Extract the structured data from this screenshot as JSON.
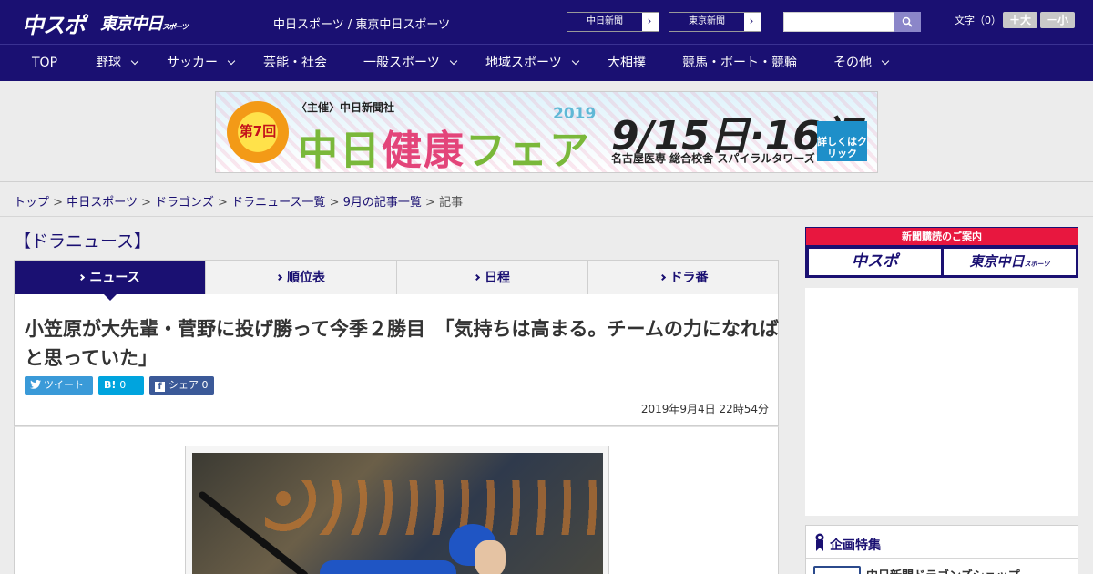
{
  "header": {
    "logo_main": "中スポ",
    "logo_sub": "東京中日",
    "logo_sub_small": "スポーツ",
    "site_title": "中日スポーツ / 東京中日スポーツ",
    "ext_links": [
      {
        "label": "中日新聞",
        "arrow": "›"
      },
      {
        "label": "東京新聞",
        "arrow": "›"
      }
    ],
    "search_placeholder": "",
    "font_size_label": "文字（0）",
    "font_larger": "＋大",
    "font_smaller": "－小"
  },
  "nav": {
    "items": [
      {
        "label": "TOP",
        "dropdown": false
      },
      {
        "label": "野球",
        "dropdown": true
      },
      {
        "label": "サッカー",
        "dropdown": true
      },
      {
        "label": "芸能・社会",
        "dropdown": false
      },
      {
        "label": "一般スポーツ",
        "dropdown": true
      },
      {
        "label": "地域スポーツ",
        "dropdown": true
      },
      {
        "label": "大相撲",
        "dropdown": false
      },
      {
        "label": "競馬・ボート・競輪",
        "dropdown": false
      },
      {
        "label": "その他",
        "dropdown": true
      }
    ]
  },
  "banner": {
    "flower_text": "第7回",
    "sponsor": "〈主催〉中日新聞社",
    "year": "2019",
    "title_a": "中日",
    "title_b": "健康",
    "title_c": "フェア",
    "dates": "9/15日·16祝",
    "venue": "名古屋医専 総合校舎 スパイラルタワーズ",
    "detail_label": "詳しくはクリック"
  },
  "breadcrumb": {
    "links": [
      "トップ",
      "中日スポーツ",
      "ドラゴンズ",
      "ドラニュース一覧",
      "9月の記事一覧"
    ],
    "current": "記事",
    "separator": ">"
  },
  "section_heading": "【ドラニュース】",
  "tabs": [
    {
      "label": "ニュース",
      "active": true
    },
    {
      "label": "順位表",
      "active": false
    },
    {
      "label": "日程",
      "active": false
    },
    {
      "label": "ドラ番",
      "active": false
    }
  ],
  "article": {
    "headline": "小笠原が大先輩・菅野に投げ勝って今季２勝目　「気持ちは高まる。チームの力になればと思っていた」",
    "share": {
      "tweet_label": "ツイート",
      "hatena_label": "B!",
      "hatena_count": "0",
      "facebook_label": "シェア",
      "facebook_count": "0"
    },
    "published": "2019年9月4日 22時54分"
  },
  "sidebar": {
    "subscription_head": "新聞購読のご案内",
    "sub_a": "中スポ",
    "sub_b": "東京中日",
    "sub_b_small": "スポーツ",
    "feature_title": "企画特集",
    "feature_item": "中日新聞ドラゴンズショップ"
  },
  "colors": {
    "brand_navy": "#1a1072",
    "accent_red": "#e8173f",
    "twitter": "#3a9ad8",
    "hatena": "#00a4de",
    "facebook": "#3b5998"
  }
}
